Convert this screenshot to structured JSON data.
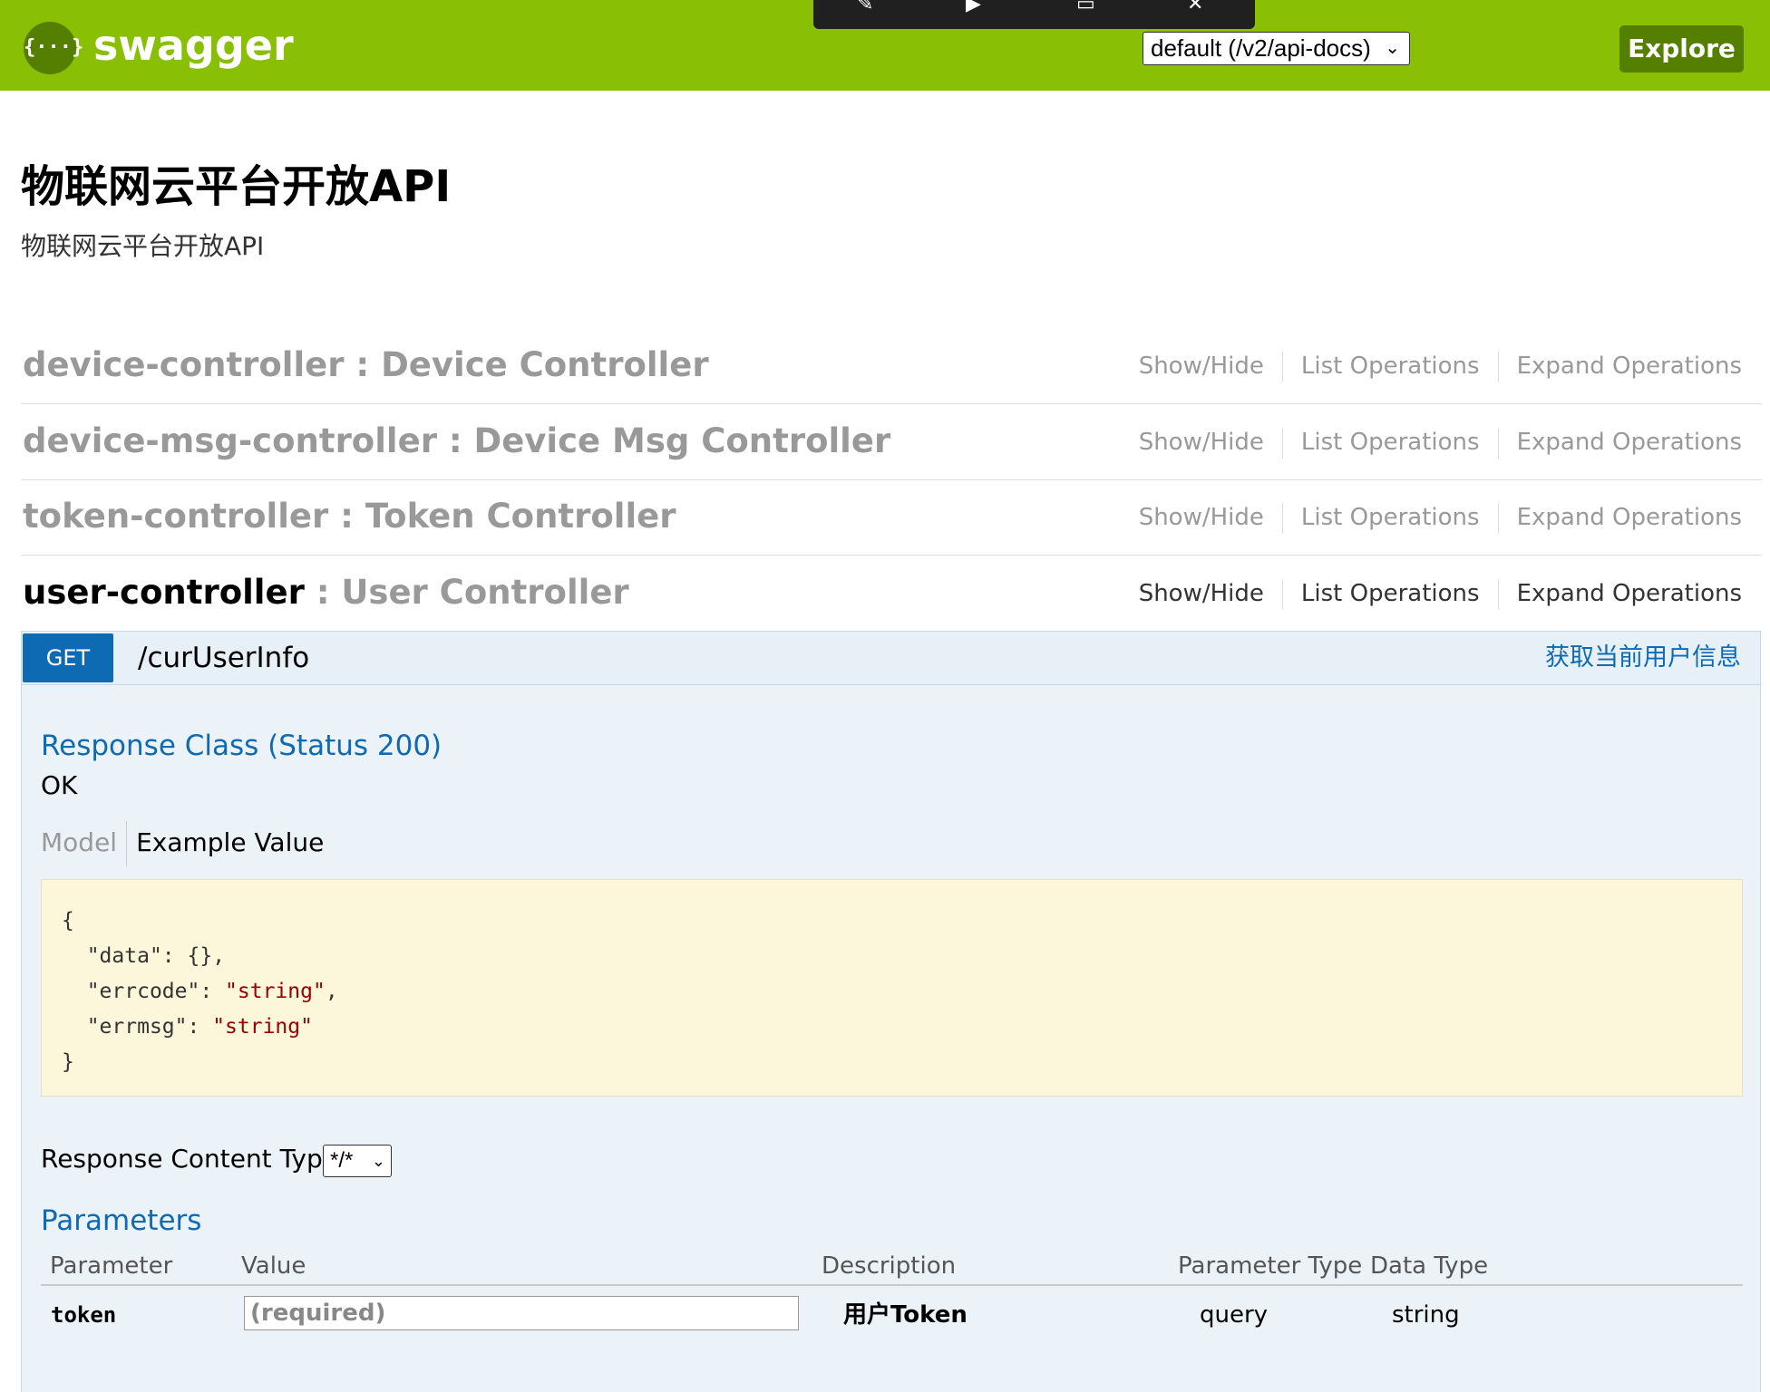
{
  "header": {
    "logo_glyph": "{···}",
    "brand": "swagger",
    "spec_selector": "default (/v2/api-docs)",
    "explore_label": "Explore",
    "media_bar_icons": [
      "mic-muted-icon",
      "camera-off-icon",
      "share-screen-icon",
      "close-icon"
    ]
  },
  "info": {
    "title": "物联网云平台开放API",
    "description": "物联网云平台开放API"
  },
  "resources": [
    {
      "name": "device-controller",
      "description": "Device Controller",
      "show_hide": "Show/Hide",
      "list_ops": "List Operations",
      "expand_ops": "Expand Operations"
    },
    {
      "name": "device-msg-controller",
      "description": "Device Msg Controller",
      "show_hide": "Show/Hide",
      "list_ops": "List Operations",
      "expand_ops": "Expand Operations"
    },
    {
      "name": "token-controller",
      "description": "Token Controller",
      "show_hide": "Show/Hide",
      "list_ops": "List Operations",
      "expand_ops": "Expand Operations"
    },
    {
      "name": "user-controller",
      "description": "User Controller",
      "show_hide": "Show/Hide",
      "list_ops": "List Operations",
      "expand_ops": "Expand Operations"
    }
  ],
  "operation": {
    "method": "GET",
    "path": "/curUserInfo",
    "summary": "获取当前用户信息",
    "response_class_title": "Response Class (Status 200)",
    "response_status_text": "OK",
    "model_tab": "Model",
    "example_tab": "Example Value",
    "example_json": {
      "open": "{",
      "data_key": "\"data\"",
      "data_val": "{}",
      "errcode_key": "\"errcode\"",
      "errcode_val": "\"string\"",
      "errmsg_key": "\"errmsg\"",
      "errmsg_val": "\"string\"",
      "close": "}"
    },
    "response_content_type_label": "Response Content Type",
    "response_content_type_value": "*/*",
    "parameters_title": "Parameters",
    "param_headers": [
      "Parameter",
      "Value",
      "Description",
      "Parameter Type",
      "Data Type"
    ],
    "params": [
      {
        "name": "token",
        "placeholder": "(required)",
        "description": "用户Token",
        "param_type": "query",
        "data_type": "string"
      }
    ]
  },
  "colors": {
    "header_bg": "#89bf04",
    "header_dark": "#547f00",
    "get_blue": "#0f6ab4",
    "operation_bg": "#ebf3f9",
    "snippet_bg": "#fcf6db"
  }
}
